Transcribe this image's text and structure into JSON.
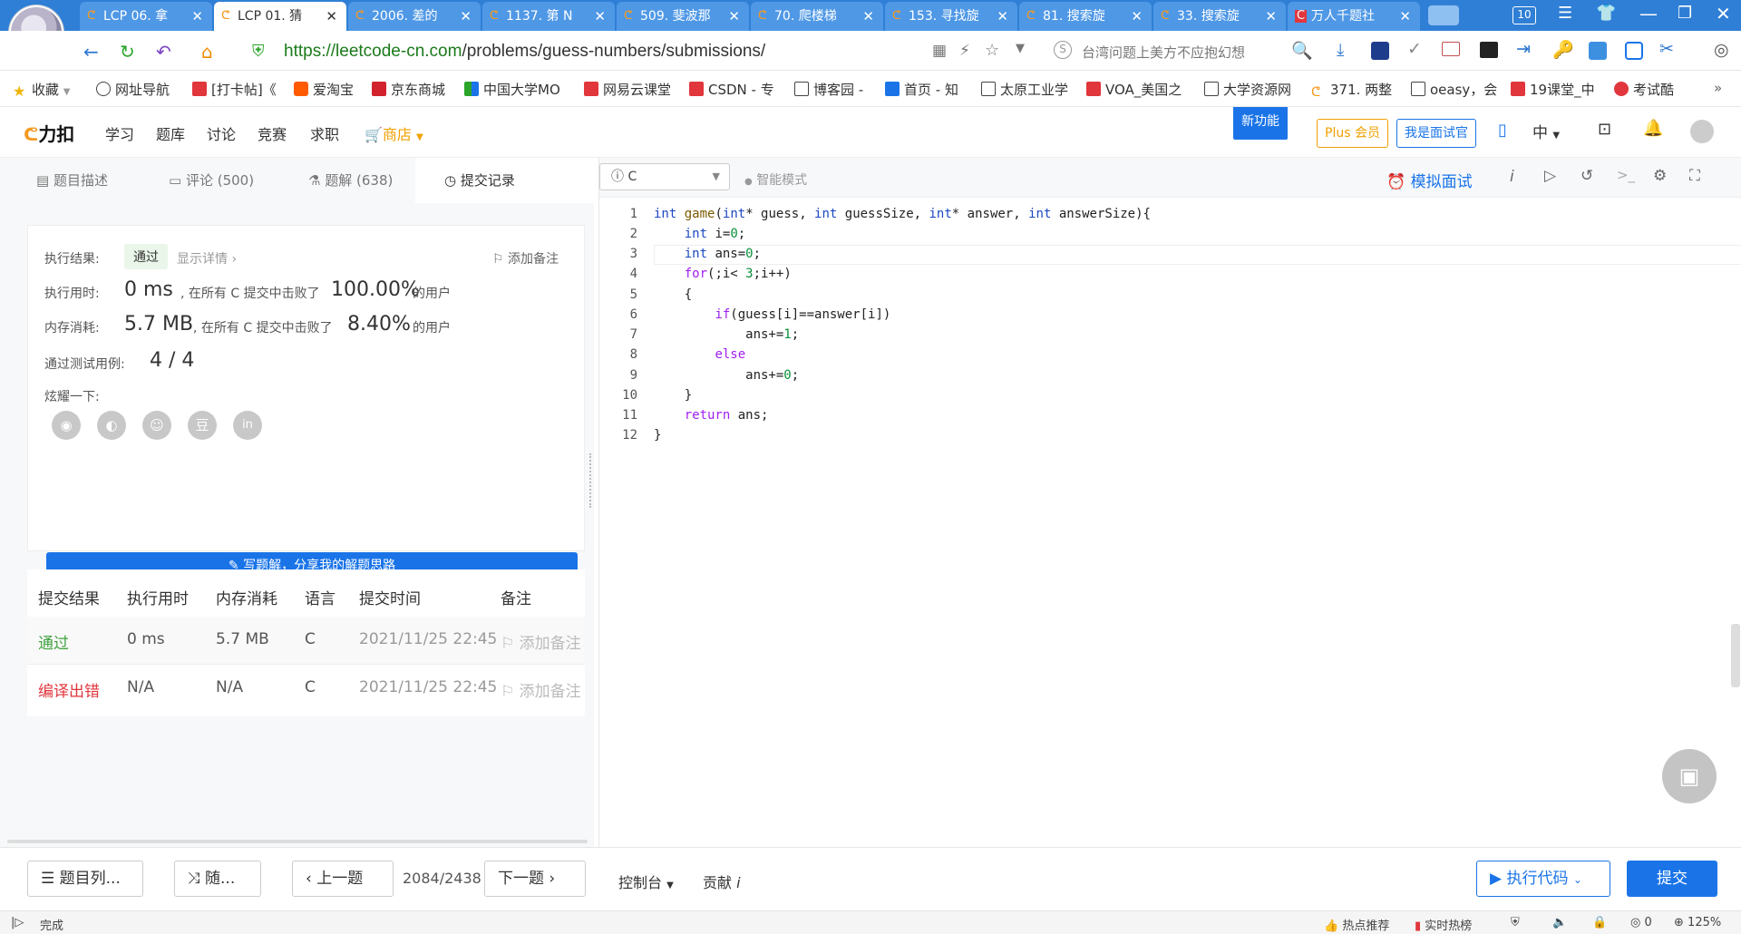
{
  "browser": {
    "tabs": [
      {
        "title": "LCP 06. 拿",
        "active": false
      },
      {
        "title": "LCP 01. 猜",
        "active": true
      },
      {
        "title": "2006. 差的",
        "active": false
      },
      {
        "title": "1137. 第 N",
        "active": false
      },
      {
        "title": "509. 斐波那",
        "active": false
      },
      {
        "title": "70. 爬楼梯",
        "active": false
      },
      {
        "title": "153. 寻找旋",
        "active": false
      },
      {
        "title": "81. 搜索旋",
        "active": false
      },
      {
        "title": "33. 搜索旋",
        "active": false
      },
      {
        "title": "万人千题社",
        "active": false
      }
    ],
    "tab_count_badge": "10",
    "url_domain": "https://leetcode-cn.com",
    "url_path": "/problems/guess-numbers/submissions/",
    "search_hint": "台湾问题上美方不应抱幻想",
    "bookmarks": [
      "收藏",
      "网址导航",
      "[打卡帖]《",
      "爱淘宝",
      "京东商城",
      "中国大学MO",
      "网易云课堂",
      "CSDN - 专",
      "博客园 -",
      "首页 - 知",
      "太原工业学",
      "VOA_美国之",
      "大学资源网",
      "371. 两整",
      "oeasy，会",
      "19课堂_中",
      "考试酷"
    ]
  },
  "leetcode": {
    "logo": "力扣",
    "nav": [
      "学习",
      "题库",
      "讨论",
      "竞赛",
      "求职",
      "商店"
    ],
    "new_feature": "新功能",
    "plus_label": "Plus 会员",
    "interviewer_label": "我是面试官",
    "lang_switch": "中"
  },
  "left_tabs": [
    {
      "label": "题目描述"
    },
    {
      "label": "评论 (500)"
    },
    {
      "label": "题解 (638)"
    },
    {
      "label": "提交记录"
    }
  ],
  "result": {
    "result_label": "执行结果:",
    "result_value": "通过",
    "show_details": "显示详情 ›",
    "add_note": "添加备注",
    "time_label": "执行用时:",
    "time_value": "0 ms",
    "time_mid": ", 在所有 C 提交中击败了",
    "time_pct": "100.00%",
    "users_suffix": "的用户",
    "mem_label": "内存消耗:",
    "mem_value": "5.7 MB",
    "mem_mid": ", 在所有 C 提交中击败了",
    "mem_pct": "8.40%",
    "tests_label": "通过测试用例:",
    "tests_value": "4 / 4",
    "share_label": "炫耀一下:",
    "write_btn": "写题解，分享我的解题思路"
  },
  "submissions": {
    "headers": [
      "提交结果",
      "执行用时",
      "内存消耗",
      "语言",
      "提交时间",
      "备注"
    ],
    "rows": [
      {
        "status": "通过",
        "time": "0 ms",
        "memory": "5.7 MB",
        "lang": "C",
        "submitted": "2021/11/25 22:45",
        "note": "添加备注"
      },
      {
        "status": "编译出错",
        "time": "N/A",
        "memory": "N/A",
        "lang": "C",
        "submitted": "2021/11/25 22:45",
        "note": "添加备注"
      }
    ]
  },
  "editor": {
    "language": "C",
    "smart_mode": "智能模式",
    "mock_interview": "模拟面试",
    "line_numbers": [
      "1",
      "2",
      "3",
      "4",
      "5",
      "6",
      "7",
      "8",
      "9",
      "10",
      "11",
      "12"
    ]
  },
  "bottom": {
    "problem_list": "题目列...",
    "random": "随...",
    "prev": "上一题",
    "progress": "2084/2438",
    "next": "下一题",
    "console": "控制台",
    "contribute": "贡献",
    "run_code": "执行代码",
    "submit": "提交"
  },
  "status": {
    "state": "完成",
    "hot": "热点推荐",
    "realtime": "实时热榜",
    "zero": "0",
    "zoom": "125%"
  },
  "colors": {
    "accent": "#1a74e8",
    "success": "#3fa33f",
    "error": "#e0363c",
    "tabbar": "#2f7fd6"
  }
}
